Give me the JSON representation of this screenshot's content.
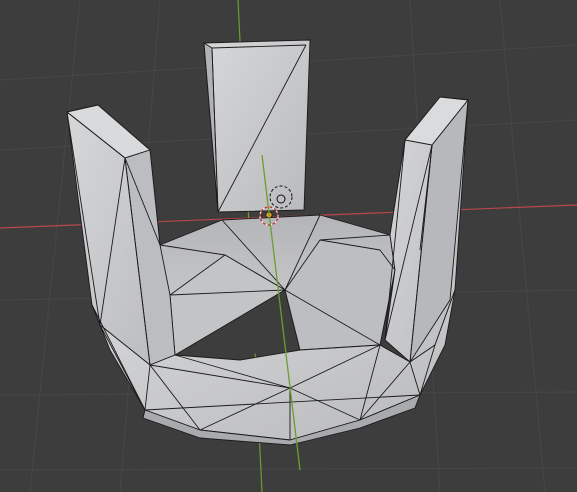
{
  "viewport": {
    "name": "3D Viewport",
    "background": "#3d3d3d",
    "grid_line_color": "#4a4a4a",
    "x_axis_color": "#b8474d",
    "y_axis_color": "#6b9e2d",
    "mesh_face_color": "#c9cacc",
    "mesh_shadow_color": "#9a9b9e",
    "mesh_edge_color": "#1a1a1a"
  },
  "scene": {
    "object": "crown-mesh",
    "mode": "edit-wireframe-overlay",
    "gizmos": [
      "3d-cursor-icon",
      "object-origin-icon",
      "light-gizmo-icon"
    ]
  }
}
